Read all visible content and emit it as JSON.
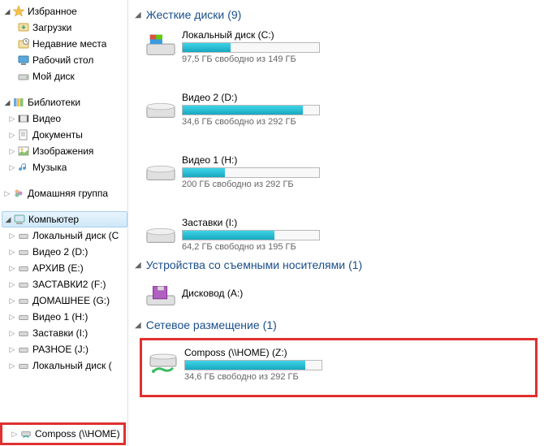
{
  "sidebar": {
    "favorites": {
      "label": "Избранное",
      "items": [
        {
          "label": "Загрузки"
        },
        {
          "label": "Недавние места"
        },
        {
          "label": "Рабочий стол"
        },
        {
          "label": "Мой диск"
        }
      ]
    },
    "libraries": {
      "label": "Библиотеки",
      "items": [
        {
          "label": "Видео"
        },
        {
          "label": "Документы"
        },
        {
          "label": "Изображения"
        },
        {
          "label": "Музыка"
        }
      ]
    },
    "homegroup": {
      "label": "Домашняя группа"
    },
    "computer": {
      "label": "Компьютер",
      "items": [
        {
          "label": "Локальный диск (C"
        },
        {
          "label": "Видео 2 (D:)"
        },
        {
          "label": "АРХИВ (E:)"
        },
        {
          "label": "ЗАСТАВКИ2 (F:)"
        },
        {
          "label": "ДОМАШНЕЕ (G:)"
        },
        {
          "label": "Видео 1 (H:)"
        },
        {
          "label": "Заставки (I:)"
        },
        {
          "label": "РАЗНОЕ (J:)"
        },
        {
          "label": "Локальный диск ("
        },
        {
          "label": "Composs (\\\\HOME)"
        }
      ]
    }
  },
  "main": {
    "hard_drives": {
      "header": "Жесткие диски",
      "count": "(9)",
      "items": [
        {
          "name": "Локальный диск (C:)",
          "status": "97,5 ГБ свободно из 149 ГБ",
          "fill_pct": 35
        },
        {
          "name": "Видео 2 (D:)",
          "status": "34,6 ГБ свободно из 292 ГБ",
          "fill_pct": 88
        },
        {
          "name": "Видео 1 (H:)",
          "status": "200 ГБ свободно из 292 ГБ",
          "fill_pct": 31
        },
        {
          "name": "Заставки (I:)",
          "status": "64,2 ГБ свободно из 195 ГБ",
          "fill_pct": 67
        }
      ]
    },
    "removable": {
      "header": "Устройства со съемными носителями",
      "count": "(1)",
      "items": [
        {
          "name": "Дисковод (A:)"
        }
      ]
    },
    "network": {
      "header": "Сетевое размещение",
      "count": "(1)",
      "items": [
        {
          "name": "Composs (\\\\HOME) (Z:)",
          "status": "34,6 ГБ свободно из 292 ГБ",
          "fill_pct": 88
        }
      ]
    }
  }
}
